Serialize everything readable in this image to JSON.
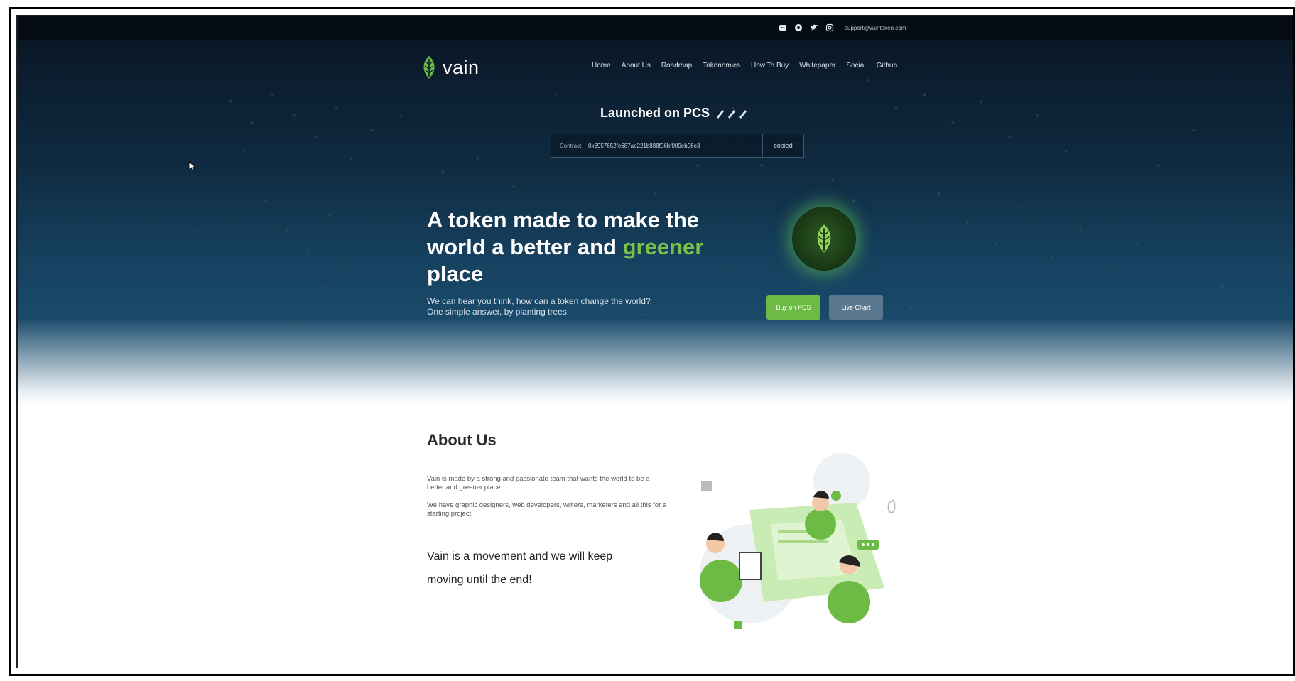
{
  "topbar": {
    "icons": [
      "discord-icon",
      "reddit-icon",
      "twitter-icon",
      "instagram-icon"
    ],
    "email": "support@vaintoken.com"
  },
  "brand": {
    "name": "vain",
    "accent": "#7cc04a"
  },
  "nav": {
    "items": [
      "Home",
      "About Us",
      "Roadmap",
      "Tokenomics",
      "How To Buy",
      "Whitepaper",
      "Social",
      "Github"
    ]
  },
  "hero": {
    "launched": "Launched on PCS",
    "contract_label": "Contract",
    "contract_address": "0x6957652fe687ae221b888f06bf009eb06e3",
    "copy_button": "copied",
    "headline_part1": "A token made to make the world a better and ",
    "headline_green": "greener",
    "headline_part2": " place",
    "subtext_line1": "We can hear you think, how can a token change the world?",
    "subtext_line2": "One simple answer, by planting trees.",
    "buy_button": "Buy on PCS",
    "chart_button": "Live Chart"
  },
  "about": {
    "title": "About Us",
    "p1": "Vain is made by a strong and passionate team that wants the world to be a better and greener place.",
    "p2": "We have graphic designers, web developers, writers, marketers and all this for a starting project!",
    "movement_line1": "Vain is a movement and we will keep",
    "movement_line2": "moving until the end!"
  },
  "colors": {
    "hero_dark": "#07111d",
    "hero_blue": "#16405e",
    "green": "#6dbb45",
    "chart_button": "#5b7891"
  }
}
